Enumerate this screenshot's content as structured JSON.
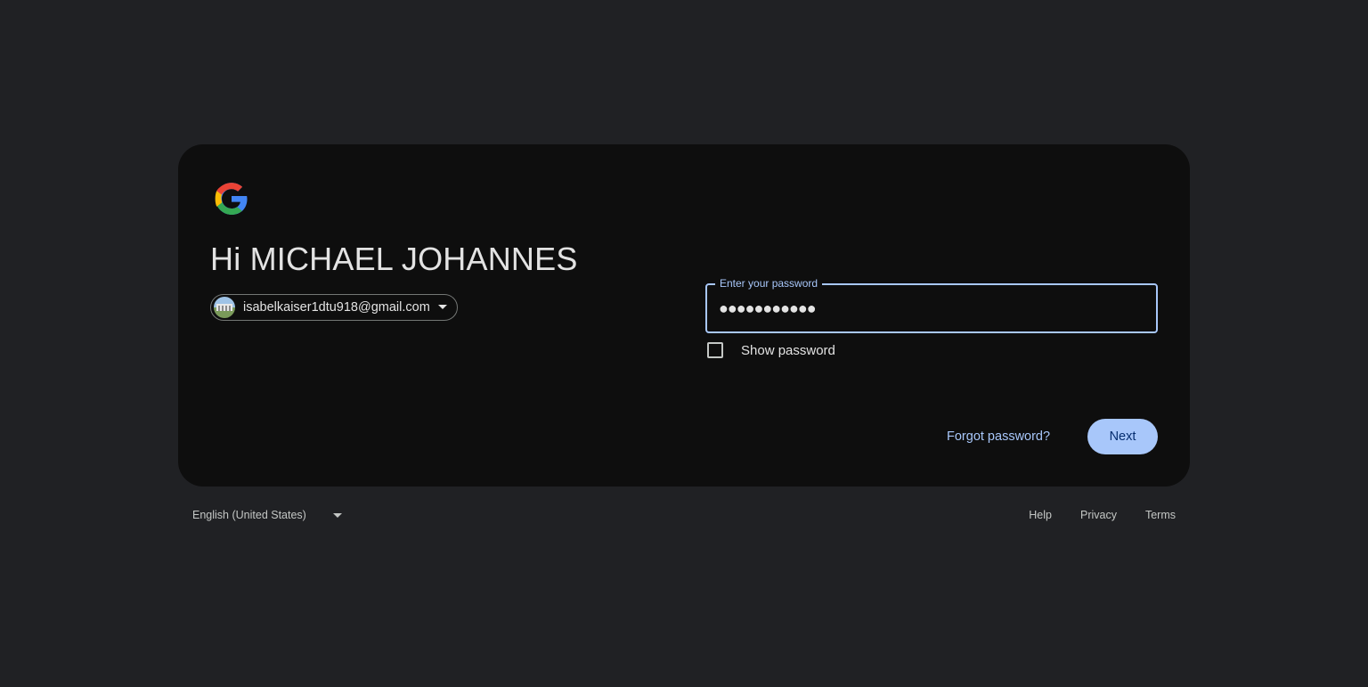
{
  "greeting": "Hi MICHAEL JOHANNES",
  "account": {
    "email": "isabelkaiser1dtu918@gmail.com"
  },
  "password_field": {
    "label": "Enter your password",
    "masked_value": "●●●●●●●●●●●"
  },
  "show_password": {
    "label": "Show password",
    "checked": false
  },
  "actions": {
    "forgot_label": "Forgot password?",
    "next_label": "Next"
  },
  "footer": {
    "language": "English (United States)",
    "links": [
      "Help",
      "Privacy",
      "Terms"
    ]
  },
  "colors": {
    "page_background": "#202124",
    "card_background": "#0e0e0e",
    "accent": "#a8c7fa",
    "button_text": "#062e6f"
  },
  "icons": {
    "logo": "google-g-logo",
    "account_caret": "chevron-down-icon",
    "language_caret": "dropdown-arrow-icon"
  }
}
